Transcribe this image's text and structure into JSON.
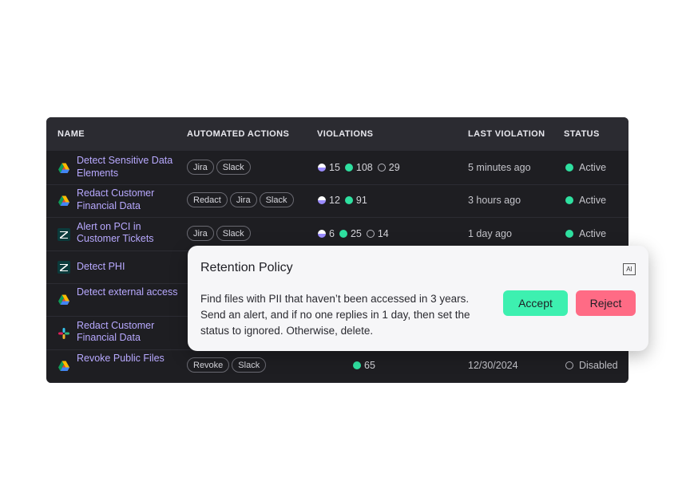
{
  "table": {
    "headers": {
      "name": "NAME",
      "actions": "AUTOMATED ACTIONS",
      "violations": "VIOLATIONS",
      "last": "LAST VIOLATION",
      "status": "STATUS"
    },
    "rows": [
      {
        "app": "google-drive",
        "name": "Detect Sensitive Data Elements",
        "tags": [
          "Jira",
          "Slack"
        ],
        "violations": [
          {
            "kind": "half",
            "n": "15"
          },
          {
            "kind": "green",
            "n": "108"
          },
          {
            "kind": "ring",
            "n": "29"
          }
        ],
        "last": "5 minutes ago",
        "status": {
          "label": "Active",
          "kind": "green"
        }
      },
      {
        "app": "google-drive",
        "name": "Redact Customer Financial Data",
        "tags": [
          "Redact",
          "Jira",
          "Slack"
        ],
        "violations": [
          {
            "kind": "half",
            "n": "12"
          },
          {
            "kind": "green",
            "n": "91"
          }
        ],
        "last": "3 hours ago",
        "status": {
          "label": "Active",
          "kind": "green"
        }
      },
      {
        "app": "zendesk",
        "name": "Alert on PCI in Customer Tickets",
        "tags": [
          "Jira",
          "Slack"
        ],
        "violations": [
          {
            "kind": "half",
            "n": "6"
          },
          {
            "kind": "green",
            "n": "25"
          },
          {
            "kind": "ring",
            "n": "14"
          }
        ],
        "last": "1 day ago",
        "status": {
          "label": "Active",
          "kind": "green"
        }
      },
      {
        "app": "zendesk",
        "name": "Detect PHI",
        "tags": [],
        "violations": [],
        "last": "",
        "status": null
      },
      {
        "app": "google-drive",
        "name": "Detect external access",
        "tags": [],
        "violations": [],
        "last": "",
        "status": null
      },
      {
        "app": "slack",
        "name": "Redact Customer Financial Data",
        "tags": [],
        "violations": [],
        "last": "",
        "status": null
      },
      {
        "app": "google-drive",
        "name": "Revoke Public Files",
        "tags": [
          "Revoke",
          "Slack"
        ],
        "violations": [
          {
            "kind": "green",
            "n": "65"
          }
        ],
        "last": "12/30/2024",
        "status": {
          "label": "Disabled",
          "kind": "ring"
        }
      }
    ]
  },
  "popup": {
    "title": "Retention Policy",
    "badge": "AI",
    "body": "Find files with PII that haven’t been accessed in 3 years. Send an alert, and if no one replies in 1 day, then set the status to ignored. Otherwise, delete.",
    "accept": "Accept",
    "reject": "Reject"
  },
  "colors": {
    "accent": "#b8a9ff",
    "green": "#2fe0a0",
    "accept": "#3df0b0",
    "reject": "#ff6b85"
  }
}
